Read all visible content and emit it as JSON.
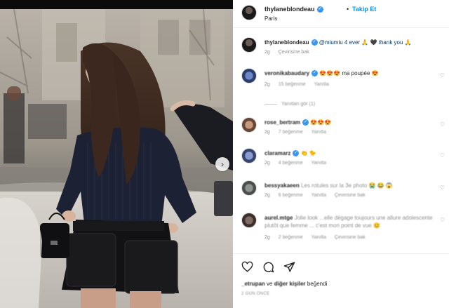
{
  "post": {
    "username": "thylaneblondeau",
    "follow_label": "Takip Et",
    "separator": "•",
    "location": "Paris"
  },
  "caption": {
    "username": "thylaneblondeau",
    "text": "@miumiu 4 ever 🙏 🖤 thank you 🙏",
    "time": "2g",
    "translate": "Çevirisine bak"
  },
  "comments": [
    {
      "username": "veronikabaudary",
      "text": "😍😍😍 ma poupée 😍",
      "time": "2g",
      "likes": "15 beğenme",
      "reply": "Yanıtla",
      "view_replies": "Yanıtları gör (1)"
    },
    {
      "username": "rose_bertram",
      "text": "😍😍😍",
      "time": "2g",
      "likes": "7 beğenme",
      "reply": "Yanıtla"
    },
    {
      "username": "claramarz",
      "text": "👏 🐤",
      "time": "2g",
      "likes": "4 beğenme",
      "reply": "Yanıtla"
    },
    {
      "username": "bessyakaeen",
      "text": "Les rotules sur la 3e photo 😭 😂 😱",
      "time": "2g",
      "likes": "6 beğenme",
      "reply": "Yanıtla",
      "translate": "Çevirisine bak"
    },
    {
      "username": "aurel.mtge",
      "text": "Jolie look ...elle dégage toujours une allure adolescente plutôt que femme ... c'est mon point de vue 😊",
      "time": "2g",
      "likes": "2 beğenme",
      "reply": "Yanıtla",
      "translate": "Çevirisine bak"
    }
  ],
  "likes_line": {
    "user1": "_etrupan",
    "connector": "ve",
    "others": "diğer kişiler",
    "suffix": "beğendi"
  },
  "timestamp": "2 GÜN ÖNCE",
  "icons": [
    "heart-icon",
    "comment-icon",
    "share-icon",
    "bookmark-icon",
    "verified-icon",
    "more-icon",
    "chevron-right-icon"
  ]
}
